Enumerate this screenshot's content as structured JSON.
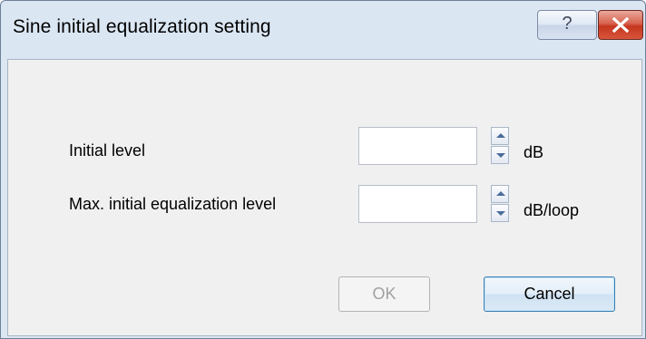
{
  "window": {
    "title": "Sine initial equalization setting"
  },
  "titlebar": {
    "help_glyph": "?",
    "close_icon": "close-icon"
  },
  "fields": [
    {
      "label": "Initial level",
      "value": "",
      "unit": "dB"
    },
    {
      "label": "Max. initial equalization level",
      "value": "",
      "unit": "dB/loop"
    }
  ],
  "buttons": {
    "ok_label": "OK",
    "ok_enabled": false,
    "cancel_label": "Cancel"
  }
}
